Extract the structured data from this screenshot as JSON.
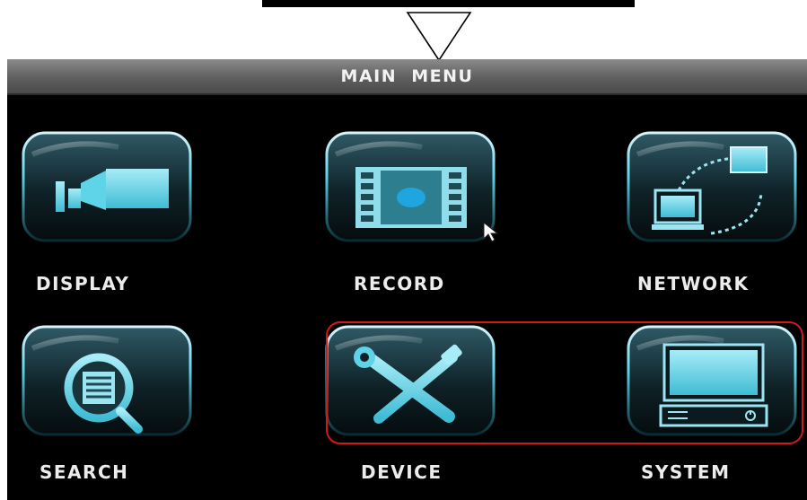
{
  "header": {
    "title": "MAIN MENU"
  },
  "menu": {
    "items": [
      {
        "label": "DISPLAY",
        "icon": "display-icon"
      },
      {
        "label": "RECORD",
        "icon": "record-icon"
      },
      {
        "label": "NETWORK",
        "icon": "network-icon"
      },
      {
        "label": "SEARCH",
        "icon": "search-icon"
      },
      {
        "label": "DEVICE",
        "icon": "device-icon"
      },
      {
        "label": "SYSTEM",
        "icon": "system-icon"
      }
    ]
  },
  "colors": {
    "accent": "#5fd3e8",
    "highlight_border": "#d11a1a",
    "header_bg": "#6a6a6a",
    "screen_bg": "#000000"
  }
}
